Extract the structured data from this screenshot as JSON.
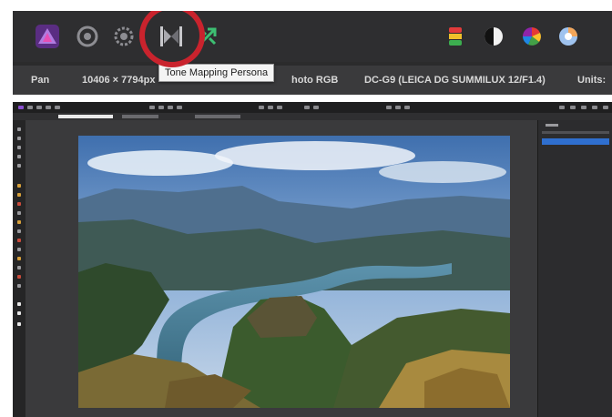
{
  "colors": {
    "highlight_ring": "#c9232d",
    "toolbar_bg": "#2e2e30",
    "context_bg": "#3a3a3c",
    "tooltip_bg": "#f4f4f4",
    "panel_selected": "#2f6fcf"
  },
  "personas": [
    {
      "icon": "photo-persona-icon",
      "active": true
    },
    {
      "icon": "liquify-persona-icon",
      "active": false
    },
    {
      "icon": "develop-persona-icon",
      "active": false
    },
    {
      "icon": "tone-mapping-persona-icon",
      "active": false,
      "highlighted": true
    },
    {
      "icon": "export-persona-icon",
      "active": false
    }
  ],
  "right_tools": [
    {
      "icon": "color-picker-icon"
    },
    {
      "icon": "contrast-icon"
    },
    {
      "icon": "color-wheel-icon"
    },
    {
      "icon": "color-balance-icon"
    }
  ],
  "context_bar": {
    "tool": "Pan",
    "dimensions": "10406 × 7794px",
    "color_profile": "hoto RGB",
    "camera": "DC-G9 (LEICA DG SUMMILUX 12/F1.4)",
    "units_label": "Units:"
  },
  "tooltip": {
    "text": "Tone Mapping Persona"
  },
  "photo": {
    "subject": "mountain-canyon-landscape"
  }
}
